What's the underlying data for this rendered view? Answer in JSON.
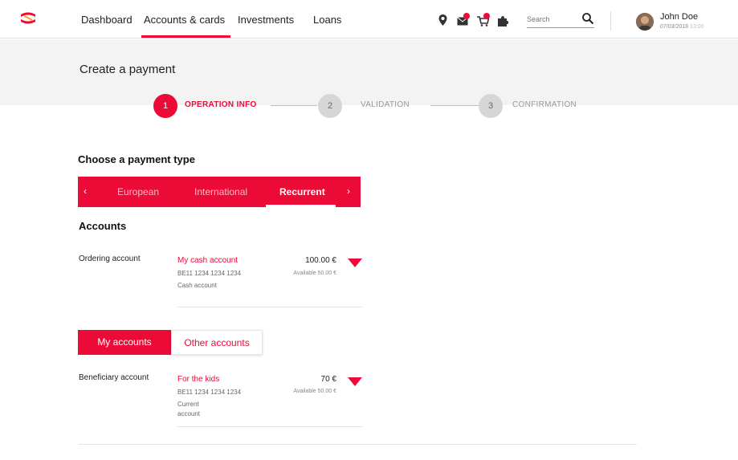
{
  "nav": {
    "items": [
      {
        "label": "Dashboard"
      },
      {
        "label": "Accounts & cards"
      },
      {
        "label": "Investments"
      },
      {
        "label": "Loans"
      }
    ],
    "active_index": 1,
    "icons": [
      "location-pin-icon",
      "mail-icon",
      "cart-icon",
      "puzzle-icon"
    ],
    "search": {
      "placeholder": "Search",
      "value": ""
    },
    "user": {
      "name": "John Doe",
      "date": "07/03/2018",
      "time": "13:00"
    }
  },
  "page": {
    "title": "Create a payment",
    "steps": [
      {
        "number": "1",
        "label": "OPERATION INFO",
        "state": "active"
      },
      {
        "number": "2",
        "label": "VALIDATION",
        "state": "idle"
      },
      {
        "number": "3",
        "label": "CONFIRMATION",
        "state": "idle"
      }
    ]
  },
  "payment_type": {
    "heading": "Choose a payment type",
    "prev_arrow": "‹",
    "next_arrow": "›",
    "tabs": [
      {
        "label": "European"
      },
      {
        "label": "International"
      },
      {
        "label": "Recurrent"
      }
    ],
    "selected_index": 2
  },
  "accounts": {
    "heading": "Accounts",
    "ordering": {
      "label": "Ordering account",
      "name": "My cash account",
      "iban": "BE11 1234 1234 1234",
      "type": "Cash account",
      "amount": "100.00 €",
      "available": "Available 50.00 €"
    },
    "toggle": {
      "options": [
        {
          "label": "My accounts"
        },
        {
          "label": "Other accounts"
        }
      ],
      "selected_index": 0
    },
    "beneficiary": {
      "label": "Beneficiary account",
      "name": "For the kids",
      "iban": "BE11 1234 1234 1234",
      "type_line1": "Current",
      "type_line2": "account",
      "amount": "70 €",
      "available": "Available 50.00 €"
    }
  },
  "colors": {
    "brand_red": "#ec0a36",
    "band_grey": "#f3f3f3",
    "step_idle_grey": "#d6d6d6"
  }
}
